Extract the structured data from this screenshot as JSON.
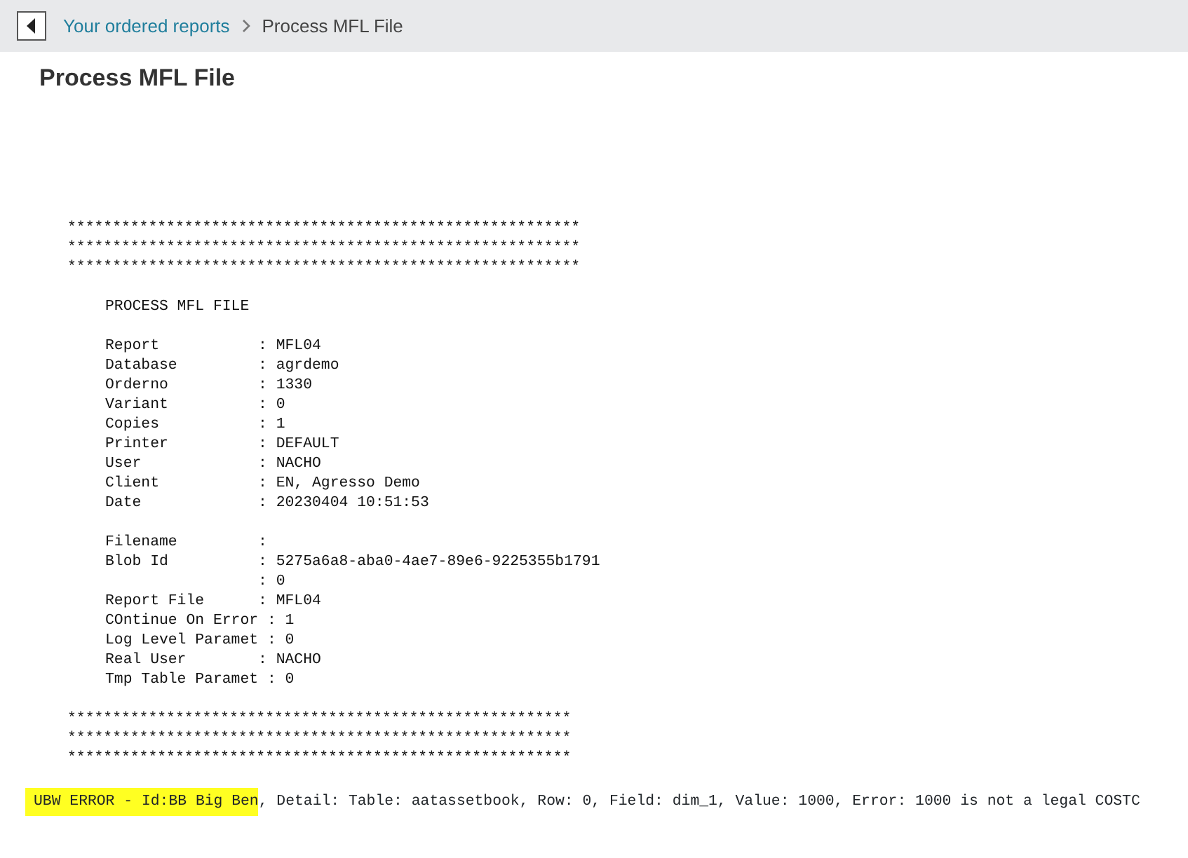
{
  "breadcrumb": {
    "items": [
      {
        "label": "Your ordered reports",
        "kind": "link"
      },
      {
        "label": "Process MFL File",
        "kind": "current"
      }
    ]
  },
  "page_title": "Process MFL File",
  "report": {
    "blocks": [
      {
        "kind": "banner",
        "lines": [
          "*********************************************************",
          "*********************************************************",
          "*********************************************************"
        ]
      },
      {
        "kind": "body",
        "lines": [
          "PROCESS MFL FILE"
        ]
      },
      {
        "kind": "body",
        "lines": [
          "Report           : MFL04",
          "Database         : agrdemo",
          "Orderno          : 1330",
          "Variant          : 0",
          "Copies           : 1",
          "Printer          : DEFAULT",
          "User             : NACHO",
          "Client           : EN, Agresso Demo",
          "Date             : 20230404 10:51:53"
        ]
      },
      {
        "kind": "body",
        "lines": [
          "Filename         :",
          "Blob Id          : 5275a6a8-aba0-4ae7-89e6-9225355b1791",
          "                 : 0",
          "Report File      : MFL04",
          "COntinue On Error : 1",
          "Log Level Paramet : 0",
          "Real User        : NACHO",
          "Tmp Table Paramet : 0"
        ]
      },
      {
        "kind": "banner",
        "lines": [
          "********************************************************",
          "********************************************************",
          "********************************************************"
        ]
      }
    ]
  },
  "error": {
    "highlighted": "UBW ERROR - Id:BB Big Ben",
    "rest": ", Detail: Table: aatassetbook, Row: 0, Field: dim_1, Value: 1000, Error: 1000 is not a legal COSTC"
  }
}
